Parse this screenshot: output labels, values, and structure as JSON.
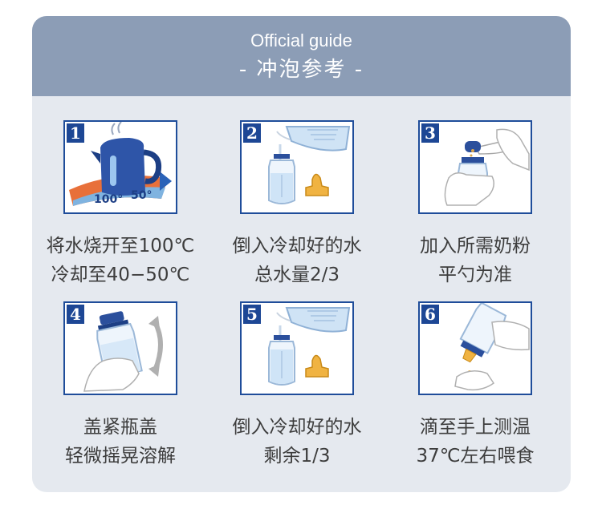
{
  "header": {
    "title_en": "Official guide",
    "title_zh": "- 冲泡参考 -"
  },
  "steps": [
    {
      "number": "1",
      "icon": "kettle-icon",
      "temp_label_1": "100°",
      "temp_label_2": "50°",
      "line1": "将水烧开至100℃",
      "line2": "冷却至40−50℃"
    },
    {
      "number": "2",
      "icon": "pour-water-icon",
      "line1": "倒入冷却好的水",
      "line2": "总水量2/3"
    },
    {
      "number": "3",
      "icon": "add-formula-icon",
      "line1": "加入所需奶粉",
      "line2": "平勺为准"
    },
    {
      "number": "4",
      "icon": "shake-bottle-icon",
      "line1": "盖紧瓶盖",
      "line2": "轻微摇晃溶解"
    },
    {
      "number": "5",
      "icon": "pour-water-icon",
      "line1": "倒入冷却好的水",
      "line2": "剩余1/3"
    },
    {
      "number": "6",
      "icon": "test-temperature-icon",
      "line1": "滴至手上测温",
      "line2": "37℃左右喂食"
    }
  ]
}
